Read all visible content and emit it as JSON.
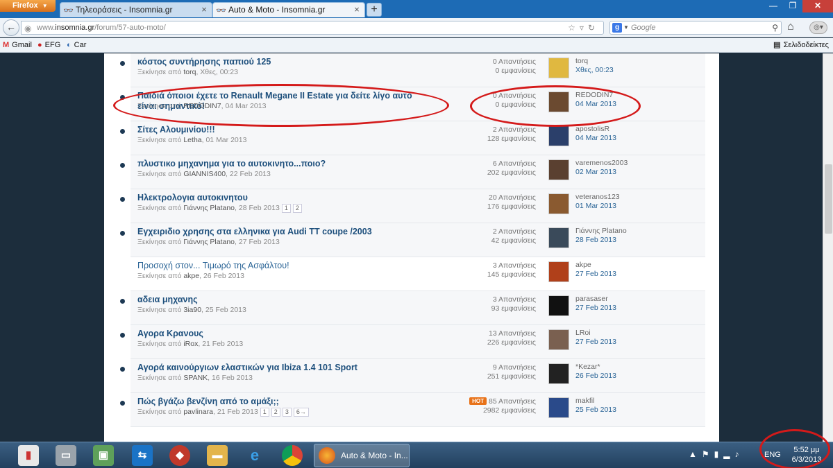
{
  "browser": {
    "menu_label": "Firefox",
    "tabs": [
      {
        "label": "Τηλεοράσεις - Insomnia.gr"
      },
      {
        "label": "Auto & Moto - Insomnia.gr"
      }
    ],
    "new_tab": "+",
    "url_prefix": "www.",
    "url_domain": "insomnia.gr",
    "url_path": "/forum/57-auto-moto/",
    "search_placeholder": "Google",
    "bookmarks": [
      {
        "label": "Gmail"
      },
      {
        "label": "EFG"
      },
      {
        "label": "Car"
      }
    ],
    "bookmarks_menu": "Σελιδοδείκτες"
  },
  "topics": [
    {
      "title": "κόστος συντήρησης παπιού 125",
      "started_label": "Ξεκίνησε από",
      "author": "torq",
      "date": "Χθες, 00:23",
      "pages": [],
      "replies": "0 Απαντήσεις",
      "views": "0 εμφανίσεις",
      "hot": "",
      "last_user": "torq",
      "last_date": "Χθες, 00:23",
      "unread": true,
      "avatar_color": "#e0b840"
    },
    {
      "title": "Παιδιά όποιοι έχετε το Renault Megane II Estate για δείτε λίγο αυτό είναι σημαντικό!",
      "started_label": "Ξεκίνησε από",
      "author": "REDODIN7",
      "date": "04 Mar 2013",
      "pages": [],
      "replies": "0 Απαντήσεις",
      "views": "0 εμφανίσεις",
      "hot": "",
      "last_user": "REDODIN7",
      "last_date": "04 Mar 2013",
      "unread": true,
      "avatar_color": "#6b4a30"
    },
    {
      "title": "Σίτες Αλουμινίου!!!",
      "started_label": "Ξεκίνησε από",
      "author": "Letha",
      "date": "01 Mar 2013",
      "pages": [],
      "replies": "2 Απαντήσεις",
      "views": "128 εμφανίσεις",
      "hot": "",
      "last_user": "apostolisR",
      "last_date": "04 Mar 2013",
      "unread": true,
      "avatar_color": "#2b3f6a"
    },
    {
      "title": "πλυστικο μηχανημα για το αυτοκινητο...ποιο?",
      "started_label": "Ξεκίνησε από",
      "author": "GIANNIS400",
      "date": "22 Feb 2013",
      "pages": [],
      "replies": "6 Απαντήσεις",
      "views": "202 εμφανίσεις",
      "hot": "",
      "last_user": "varemenos2003",
      "last_date": "02 Mar 2013",
      "unread": true,
      "avatar_color": "#5a4030"
    },
    {
      "title": "Ηλεκτρολογια αυτοκινητου",
      "started_label": "Ξεκίνησε από",
      "author": "Γιάννης Platano",
      "date": "28 Feb 2013",
      "pages": [
        "1",
        "2"
      ],
      "replies": "20 Απαντήσεις",
      "views": "176 εμφανίσεις",
      "hot": "",
      "last_user": "veteranos123",
      "last_date": "01 Mar 2013",
      "unread": true,
      "avatar_color": "#8a5a30"
    },
    {
      "title": "Εγχειριδιο χρησης στα ελληνικα για Audi TT coupe /2003",
      "started_label": "Ξεκίνησε από",
      "author": "Γιάννης Platano",
      "date": "27 Feb 2013",
      "pages": [],
      "replies": "2 Απαντήσεις",
      "views": "42 εμφανίσεις",
      "hot": "",
      "last_user": "Γιάννης Platano",
      "last_date": "28 Feb 2013",
      "unread": true,
      "avatar_color": "#3a4a5a"
    },
    {
      "title": "Προσοχή στον... Τιμωρό της Ασφάλτου!",
      "started_label": "Ξεκίνησε από",
      "author": "akpe",
      "date": "26 Feb 2013",
      "pages": [],
      "replies": "3 Απαντήσεις",
      "views": "145 εμφανίσεις",
      "hot": "",
      "last_user": "akpe",
      "last_date": "27 Feb 2013",
      "unread": false,
      "avatar_color": "#b0401a"
    },
    {
      "title": "αδεια μηχανης",
      "started_label": "Ξεκίνησε από",
      "author": "3ia90",
      "date": "25 Feb 2013",
      "pages": [],
      "replies": "3 Απαντήσεις",
      "views": "93 εμφανίσεις",
      "hot": "",
      "last_user": "parasaser",
      "last_date": "27 Feb 2013",
      "unread": true,
      "avatar_color": "#111111"
    },
    {
      "title": "Αγορα Κρανους",
      "started_label": "Ξεκίνησε από",
      "author": "iRox",
      "date": "21 Feb 2013",
      "pages": [],
      "replies": "13 Απαντήσεις",
      "views": "226 εμφανίσεις",
      "hot": "",
      "last_user": "LRoi",
      "last_date": "27 Feb 2013",
      "unread": true,
      "avatar_color": "#7a6050"
    },
    {
      "title": "Αγορά καινούργιων ελαστικών για Ibiza 1.4 101 Sport",
      "started_label": "Ξεκίνησε από",
      "author": "SPANK",
      "date": "16 Feb 2013",
      "pages": [],
      "replies": "9 Απαντήσεις",
      "views": "251 εμφανίσεις",
      "hot": "",
      "last_user": "*Kezar*",
      "last_date": "26 Feb 2013",
      "unread": true,
      "avatar_color": "#222222"
    },
    {
      "title": "Πώς βγάζω βενζίνη από το αμάξι;;",
      "started_label": "Ξεκίνησε από",
      "author": "pavlinara",
      "date": "21 Feb 2013",
      "pages": [
        "1",
        "2",
        "3",
        "6→"
      ],
      "replies": "85 Απαντήσεις",
      "views": "2982 εμφανίσεις",
      "hot": "HOT",
      "last_user": "makfil",
      "last_date": "25 Feb 2013",
      "unread": true,
      "avatar_color": "#2a4a8a"
    }
  ],
  "taskbar": {
    "active_app": "Auto & Moto - In...",
    "language": "ENG",
    "time": "5:52 μμ",
    "date": "6/3/2013"
  },
  "colors": {
    "annotation": "#d41a1a",
    "topic_link": "#1d4f7c",
    "hot_badge": "#e8731a"
  }
}
